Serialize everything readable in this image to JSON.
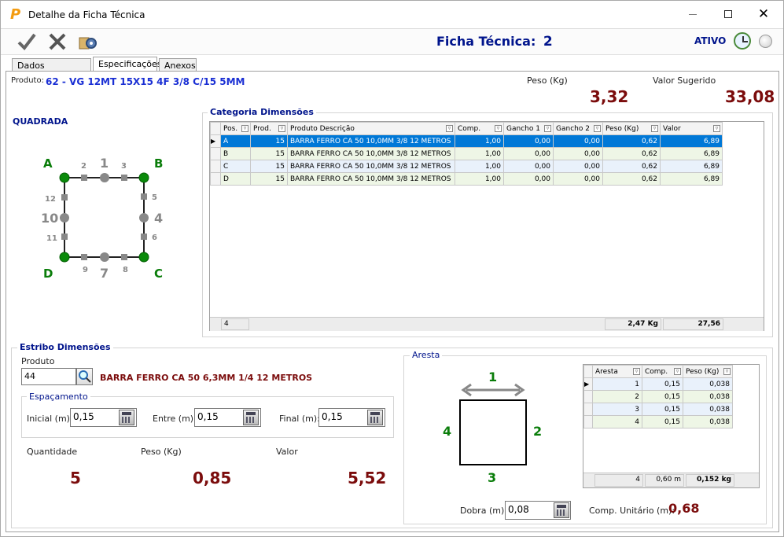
{
  "window": {
    "title": "Detalhe da Ficha Técnica",
    "app_logo": "P"
  },
  "header": {
    "ficha_label": "Ficha Técnica:",
    "ficha_num": "2",
    "status": "ATIVO"
  },
  "tabs": [
    {
      "label": "Dados Cadastrais"
    },
    {
      "label": "Especificações"
    },
    {
      "label": "Anexos"
    }
  ],
  "produto": {
    "label": "Produto:",
    "value": "62 - VG 12MT 15X15 4F 3/8 C/15 5MM"
  },
  "peso": {
    "label": "Peso (Kg)",
    "value": "3,32"
  },
  "valor_sugerido": {
    "label": "Valor Sugerido",
    "value": "33,08"
  },
  "shape": {
    "name": "QUADRADA",
    "corners": [
      "A",
      "B",
      "C",
      "D"
    ],
    "sides": [
      "1",
      "2",
      "3",
      "4",
      "5",
      "6",
      "7",
      "8",
      "9",
      "10",
      "11",
      "12"
    ]
  },
  "categoria": {
    "title": "Categoria Dimensões",
    "headers": [
      "Pos.",
      "Prod.",
      "Produto Descrição",
      "Comp.",
      "Gancho 1",
      "Gancho 2",
      "Peso (Kg)",
      "Valor"
    ],
    "rows": [
      [
        "A",
        "15",
        "BARRA FERRO CA 50 10,0MM 3/8 12 METROS",
        "1,00",
        "0,00",
        "0,00",
        "0,62",
        "6,89"
      ],
      [
        "B",
        "15",
        "BARRA FERRO CA 50 10,0MM 3/8 12 METROS",
        "1,00",
        "0,00",
        "0,00",
        "0,62",
        "6,89"
      ],
      [
        "C",
        "15",
        "BARRA FERRO CA 50 10,0MM 3/8 12 METROS",
        "1,00",
        "0,00",
        "0,00",
        "0,62",
        "6,89"
      ],
      [
        "D",
        "15",
        "BARRA FERRO CA 50 10,0MM 3/8 12 METROS",
        "1,00",
        "0,00",
        "0,00",
        "0,62",
        "6,89"
      ]
    ],
    "footer": {
      "count": "4",
      "peso": "2,47 Kg",
      "valor": "27,56"
    }
  },
  "estribo": {
    "title": "Estribo Dimensões",
    "produto_label": "Produto",
    "produto_code": "44",
    "produto_desc": "BARRA FERRO CA 50 6,3MM 1/4 12 METROS",
    "espacamento_title": "Espaçamento",
    "inicial_label": "Inicial (m):",
    "inicial": "0,15",
    "entre_label": "Entre (m):",
    "entre": "0,15",
    "final_label": "Final (m):",
    "final": "0,15",
    "quantidade_label": "Quantidade",
    "quantidade": "5",
    "peso_label": "Peso (Kg)",
    "peso": "0,85",
    "valor_label": "Valor",
    "valor": "5,52"
  },
  "aresta": {
    "title": "Aresta",
    "labels": [
      "1",
      "2",
      "3",
      "4"
    ],
    "headers": [
      "Aresta",
      "Comp.",
      "Peso (Kg)"
    ],
    "rows": [
      [
        "1",
        "0,15",
        "0,038"
      ],
      [
        "2",
        "0,15",
        "0,038"
      ],
      [
        "3",
        "0,15",
        "0,038"
      ],
      [
        "4",
        "0,15",
        "0,038"
      ]
    ],
    "footer": {
      "count": "4",
      "comp": "0,60 m",
      "peso": "0,152 kg"
    },
    "dobra_label": "Dobra (m):",
    "dobra": "0,08",
    "comp_unit_label": "Comp. Unitário (m):",
    "comp_unit": "0,68"
  }
}
